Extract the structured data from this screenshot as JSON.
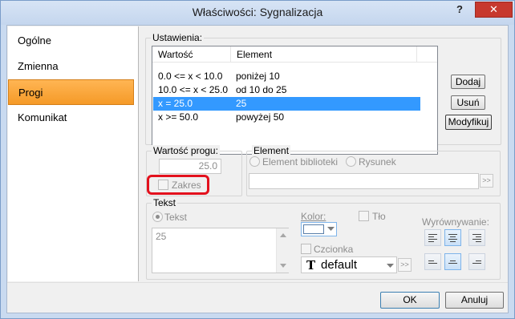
{
  "window": {
    "title": "Właściwości: Sygnalizacja",
    "help_glyph": "?",
    "close_glyph": "✕"
  },
  "nav": {
    "items": [
      {
        "label": "Ogólne",
        "active": false
      },
      {
        "label": "Zmienna",
        "active": false
      },
      {
        "label": "Progi",
        "active": true
      },
      {
        "label": "Komunikat",
        "active": false
      }
    ]
  },
  "ustawienia": {
    "legend": "Ustawienia:",
    "columns": [
      "Wartość",
      "Element"
    ],
    "rows": [
      {
        "value": "0.0 <= x < 10.0",
        "element": "poniżej 10",
        "selected": false
      },
      {
        "value": "10.0 <= x < 25.0",
        "element": "od 10 do 25",
        "selected": false
      },
      {
        "value": "x = 25.0",
        "element": "25",
        "selected": true
      },
      {
        "value": "x >= 50.0",
        "element": "powyżej 50",
        "selected": false
      }
    ],
    "buttons": {
      "add": "Dodaj",
      "remove": "Usuń",
      "modify": "Modyfikuj"
    }
  },
  "wartosc_progu": {
    "legend": "Wartość progu:",
    "value": "25.0",
    "range_label": "Zakres"
  },
  "element": {
    "legend": "Element",
    "option_library": "Element biblioteki",
    "option_drawing": "Rysunek",
    "more": ">>"
  },
  "tekst": {
    "legend": "Tekst",
    "option_text": "Tekst",
    "text_value": "25",
    "color_label": "Kolor:",
    "background_label": "Tło",
    "font_label": "Czcionka",
    "font_value": "default",
    "font_glyph": "T",
    "more": ">>",
    "alignment_label": "Wyrównywanie:"
  },
  "footer": {
    "ok": "OK",
    "cancel": "Anuluj"
  },
  "colors": {
    "accent_tab": "#f59a28",
    "selection": "#3399ff",
    "highlight_ring": "#e3111d",
    "close": "#c7392e"
  }
}
